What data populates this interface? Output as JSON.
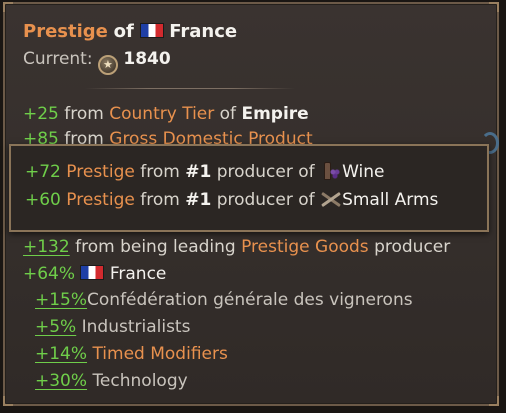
{
  "tooltip": {
    "title_prefix": "Prestige",
    "title_of": "of",
    "country": "France",
    "current_label": "Current:",
    "current_value": "1840"
  },
  "lines": {
    "tier": {
      "value": "+25",
      "from": "from",
      "source": "Country Tier",
      "of": "of",
      "target": "Empire"
    },
    "gdp": {
      "value": "+85",
      "from": "from",
      "source": "Gross Domestic Product"
    },
    "leading": {
      "value": "+132",
      "text": "from being leading",
      "source": "Prestige Goods",
      "tail": "producer"
    },
    "france_pct": {
      "value": "+64%",
      "name": "France"
    },
    "mod1": {
      "value": "+15%",
      "name": "Confédération générale des vignerons"
    },
    "mod2": {
      "value": "+5%",
      "name": "Industrialists"
    },
    "mod3": {
      "value": "+14%",
      "name": "Timed Modifiers"
    },
    "mod4": {
      "value": "+30%",
      "name": "Technology"
    }
  },
  "subtooltip": {
    "row1": {
      "value": "+72",
      "label": "Prestige",
      "from": "from",
      "rank": "#1",
      "producer_of": "producer of",
      "good": "Wine"
    },
    "row2": {
      "value": "+60",
      "label": "Prestige",
      "from": "from",
      "rank": "#1",
      "producer_of": "producer of",
      "good": "Small Arms"
    }
  },
  "colors": {
    "positive": "#6fce4a",
    "highlight": "#e8914e",
    "border": "#8a7458"
  },
  "icons": {
    "flag": "france-flag-icon",
    "prestige": "prestige-coin-icon",
    "wine": "wine-icon",
    "arms": "small-arms-icon"
  }
}
